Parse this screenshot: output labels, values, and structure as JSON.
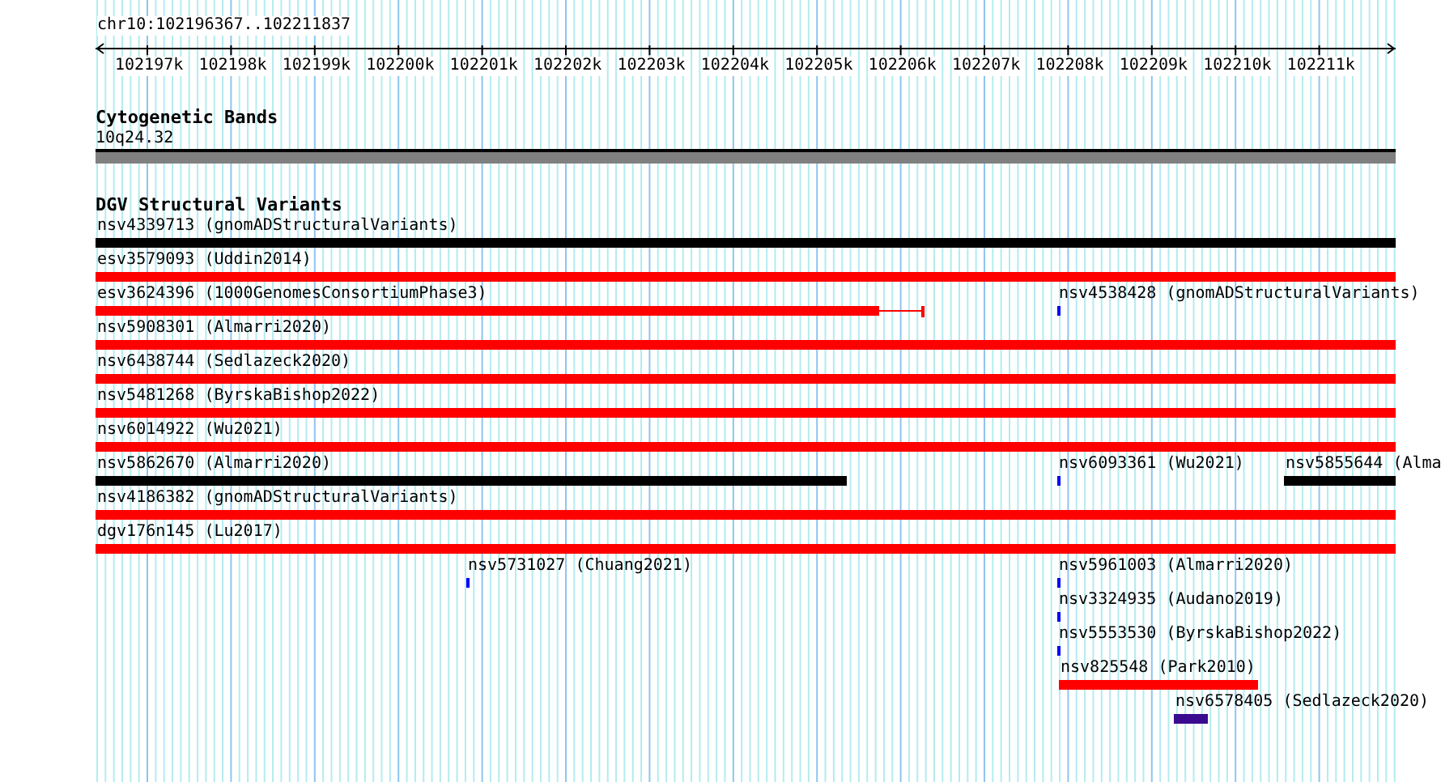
{
  "ruler": {
    "location": "chr10:102196367..102211837",
    "ticks": [
      "102197k",
      "102198k",
      "102199k",
      "102200k",
      "102201k",
      "102202k",
      "102203k",
      "102204k",
      "102205k",
      "102206k",
      "102207k",
      "102208k",
      "102209k",
      "102210k",
      "102211k"
    ]
  },
  "tracks": [
    {
      "kind": "bands",
      "title": "Cytogenetic Bands",
      "bands": [
        {
          "label": "10q24.32",
          "color": "#808080"
        }
      ]
    },
    {
      "kind": "features",
      "title": "DGV Structural Variants",
      "features": [
        {
          "label": "nsv4339713 (gnomADStructuralVariants)",
          "color": "#000000"
        },
        {
          "label": "esv3579093 (Uddin2014)",
          "color": "#ff0000"
        },
        {
          "label": "esv3624396 (1000GenomesConsortiumPhase3)",
          "color": "#ff0000"
        },
        {
          "label": "nsv4538428 (gnomADStructuralVariants)",
          "color": "#0000ff"
        },
        {
          "label": "nsv5908301 (Almarri2020)",
          "color": "#ff0000"
        },
        {
          "label": "nsv6438744 (Sedlazeck2020)",
          "color": "#ff0000"
        },
        {
          "label": "nsv5481268 (ByrskaBishop2022)",
          "color": "#ff0000"
        },
        {
          "label": "nsv6014922 (Wu2021)",
          "color": "#ff0000"
        },
        {
          "label": "nsv5862670 (Almarri2020)",
          "color": "#000000"
        },
        {
          "label": "nsv6093361 (Wu2021)",
          "color": "#0000ff"
        },
        {
          "label": "nsv5855644 (Alma",
          "color": "#000000"
        },
        {
          "label": "nsv4186382 (gnomADStructuralVariants)",
          "color": "#ff0000"
        },
        {
          "label": "dgv176n145 (Lu2017)",
          "color": "#ff0000"
        },
        {
          "label": "nsv5731027 (Chuang2021)",
          "color": "#0000ff"
        },
        {
          "label": "nsv5961003 (Almarri2020)",
          "color": "#0000ff"
        },
        {
          "label": "nsv3324935 (Audano2019)",
          "color": "#0000ff"
        },
        {
          "label": "nsv5553530 (ByrskaBishop2022)",
          "color": "#0000ff"
        },
        {
          "label": "nsv825548 (Park2010)",
          "color": "#ff0000"
        },
        {
          "label": "nsv6578405 (Sedlazeck2020)",
          "color": "#3a0a8f"
        }
      ]
    }
  ]
}
